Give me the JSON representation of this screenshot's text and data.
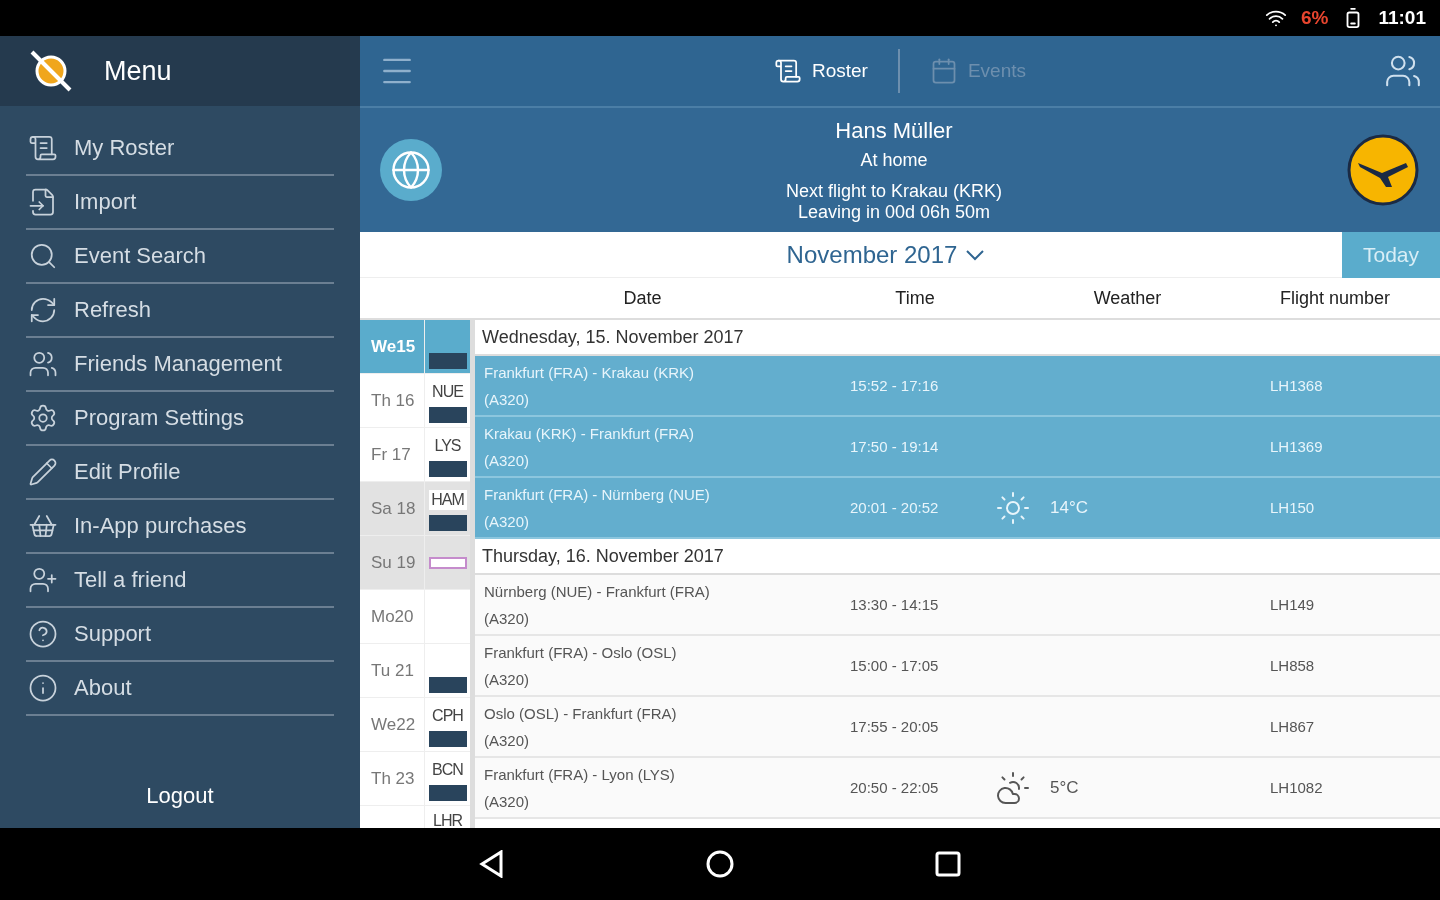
{
  "status_bar": {
    "battery": "6%",
    "time": "11:01"
  },
  "sidebar": {
    "title": "Menu",
    "items": [
      {
        "label": "My Roster"
      },
      {
        "label": "Import"
      },
      {
        "label": "Event Search"
      },
      {
        "label": "Refresh"
      },
      {
        "label": "Friends Management"
      },
      {
        "label": "Program Settings"
      },
      {
        "label": "Edit Profile"
      },
      {
        "label": "In-App purchases"
      },
      {
        "label": "Tell a friend"
      },
      {
        "label": "Support"
      },
      {
        "label": "About"
      }
    ],
    "logout": "Logout"
  },
  "tabs": [
    {
      "label": "Roster",
      "selected": true
    },
    {
      "label": "Events",
      "selected": false
    }
  ],
  "profile": {
    "name": "Hans Müller",
    "status": "At home",
    "next_flight": "Next flight to Krakau (KRK)",
    "leaving": "Leaving in 00d 06h 50m"
  },
  "month": "November 2017",
  "today_button": "Today",
  "columns": [
    "Date",
    "Time",
    "Weather",
    "Flight number"
  ],
  "days": [
    {
      "label": "We15",
      "selected": true,
      "weekend": false,
      "strip": [
        {
          "kind": "block"
        }
      ]
    },
    {
      "label": "Th 16",
      "selected": false,
      "weekend": false,
      "strip": [
        {
          "kind": "code",
          "text": "NUE"
        },
        {
          "kind": "block"
        }
      ]
    },
    {
      "label": "Fr  17",
      "selected": false,
      "weekend": false,
      "strip": [
        {
          "kind": "code",
          "text": "LYS"
        },
        {
          "kind": "block"
        }
      ]
    },
    {
      "label": "Sa 18",
      "selected": false,
      "weekend": true,
      "strip": [
        {
          "kind": "code",
          "text": "HAM"
        },
        {
          "kind": "block"
        }
      ]
    },
    {
      "label": "Su 19",
      "selected": false,
      "weekend": true,
      "strip": [
        {
          "kind": "marker"
        }
      ]
    },
    {
      "label": "Mo20",
      "selected": false,
      "weekend": false
    },
    {
      "label": "Tu 21",
      "selected": false,
      "weekend": false,
      "strip": [
        {
          "kind": "block"
        }
      ]
    },
    {
      "label": "We22",
      "selected": false,
      "weekend": false,
      "strip": [
        {
          "kind": "code",
          "text": "CPH"
        },
        {
          "kind": "block"
        }
      ]
    },
    {
      "label": "Th 23",
      "selected": false,
      "weekend": false,
      "strip": [
        {
          "kind": "code",
          "text": "BCN"
        },
        {
          "kind": "block"
        }
      ]
    },
    {
      "selected": false,
      "weekend": false,
      "strip": [
        {
          "kind": "code",
          "text": "LHR"
        }
      ]
    }
  ],
  "sections": [
    {
      "date": "Wednesday, 15. November 2017",
      "flights": [
        {
          "route": "Frankfurt (FRA) - Krakau (KRK)",
          "aircraft": "(A320)",
          "time": "15:52 - 17:16",
          "flight": "LH1368",
          "selected": true
        },
        {
          "route": "Krakau (KRK) - Frankfurt (FRA)",
          "aircraft": "(A320)",
          "time": "17:50 - 19:14",
          "flight": "LH1369",
          "selected": true
        },
        {
          "route": "Frankfurt (FRA) - Nürnberg (NUE)",
          "aircraft": "(A320)",
          "time": "20:01 - 20:52",
          "weather": {
            "kind": "sun",
            "temp": "14°C"
          },
          "flight": "LH150",
          "selected": true
        }
      ]
    },
    {
      "date": "Thursday, 16. November 2017",
      "flights": [
        {
          "route": "Nürnberg (NUE) - Frankfurt (FRA)",
          "aircraft": "(A320)",
          "time": "13:30 - 14:15",
          "flight": "LH149",
          "selected": false
        },
        {
          "route": "Frankfurt (FRA) - Oslo (OSL)",
          "aircraft": "(A320)",
          "time": "15:00 - 17:05",
          "flight": "LH858",
          "selected": false
        },
        {
          "route": "Oslo (OSL) - Frankfurt (FRA)",
          "aircraft": "(A320)",
          "time": "17:55 - 20:05",
          "flight": "LH867",
          "selected": false
        },
        {
          "route": "Frankfurt (FRA) - Lyon (LYS)",
          "aircraft": "(A320)",
          "time": "20:50 - 22:05",
          "weather": {
            "kind": "cloud",
            "temp": "5°C"
          },
          "flight": "LH1082",
          "selected": false
        }
      ]
    }
  ]
}
